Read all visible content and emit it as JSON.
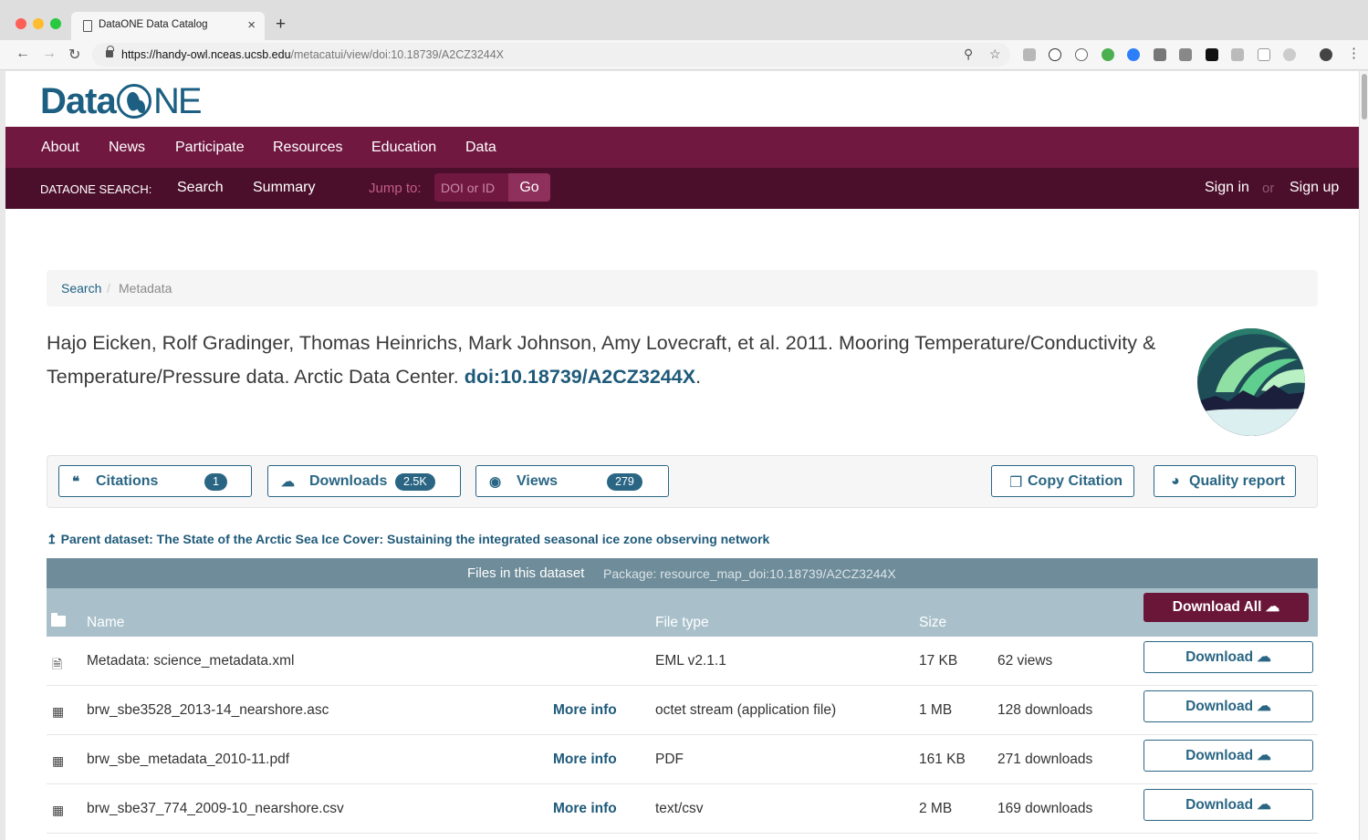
{
  "browser": {
    "tab_title": "DataONE Data Catalog",
    "tab_close": "×",
    "new_tab": "+",
    "url_host": "https://handy-owl.nceas.ucsb.edu",
    "url_path": "/metacatui/view/doi:10.18739/A2CZ3244X",
    "nav": {
      "back": "←",
      "forward": "→",
      "reload": "↻"
    },
    "extensions": [
      "zoom-icon",
      "bookmark-star-icon",
      "extension-icons",
      "profile-icon",
      "menu-icon"
    ]
  },
  "logo": {
    "part1": "Data",
    "part2": "NE",
    "alt": "DataONE"
  },
  "main_nav": [
    "About",
    "News",
    "Participate",
    "Resources",
    "Education",
    "Data"
  ],
  "sub_nav": {
    "label": "DATAONE SEARCH:",
    "items": [
      "Search",
      "Summary"
    ],
    "jump_label": "Jump to:",
    "jump_placeholder": "DOI or ID",
    "go": "Go",
    "sign_in": "Sign in",
    "or": "or",
    "sign_up": "Sign up"
  },
  "breadcrumb": {
    "search": "Search",
    "sep": "/",
    "current": "Metadata"
  },
  "citation": {
    "text": "Hajo Eicken, Rolf Gradinger, Thomas Heinrichs, Mark Johnson, Amy Lovecraft, et al. 2011. Mooring Temperature/Conductivity & Temperature/Pressure data. Arctic Data Center. ",
    "doi": "doi:10.18739/A2CZ3244X",
    "end": "."
  },
  "metrics": {
    "citations": {
      "label": "Citations",
      "count": "1",
      "icon": "quote-icon"
    },
    "downloads": {
      "label": "Downloads",
      "count": "2.5K",
      "icon": "cloud-download-icon"
    },
    "views": {
      "label": "Views",
      "count": "279",
      "icon": "eye-icon"
    }
  },
  "actions": {
    "copy_citation": "Copy Citation",
    "quality_report": "Quality report"
  },
  "parent": "↥ Parent dataset: The State of the Arctic Sea Ice Cover: Sustaining the integrated seasonal ice zone observing network",
  "files": {
    "title": "Files in this dataset",
    "package": "Package: resource_map_doi:10.18739/A2CZ3244X",
    "columns": {
      "name": "Name",
      "type": "File type",
      "size": "Size"
    },
    "download_all": "Download All",
    "rows": [
      {
        "name": "Metadata: science_metadata.xml",
        "more": "",
        "type": "EML v2.1.1",
        "size": "17 KB",
        "stat": "62 views",
        "download": "Download",
        "icon": "document-icon"
      },
      {
        "name": "brw_sbe3528_2013-14_nearshore.asc",
        "more": "More info",
        "type": "octet stream (application file)",
        "size": "1 MB",
        "stat": "128 downloads",
        "download": "Download",
        "icon": "table-icon"
      },
      {
        "name": "brw_sbe_metadata_2010-11.pdf",
        "more": "More info",
        "type": "PDF",
        "size": "161 KB",
        "stat": "271 downloads",
        "download": "Download",
        "icon": "table-icon"
      },
      {
        "name": "brw_sbe37_774_2009-10_nearshore.csv",
        "more": "More info",
        "type": "text/csv",
        "size": "2 MB",
        "stat": "169 downloads",
        "download": "Download",
        "icon": "table-icon"
      }
    ]
  },
  "colors": {
    "nav": "#711841",
    "subnav": "#4c0f2b",
    "accent": "#2a6684",
    "logo": "#1c5f82"
  }
}
